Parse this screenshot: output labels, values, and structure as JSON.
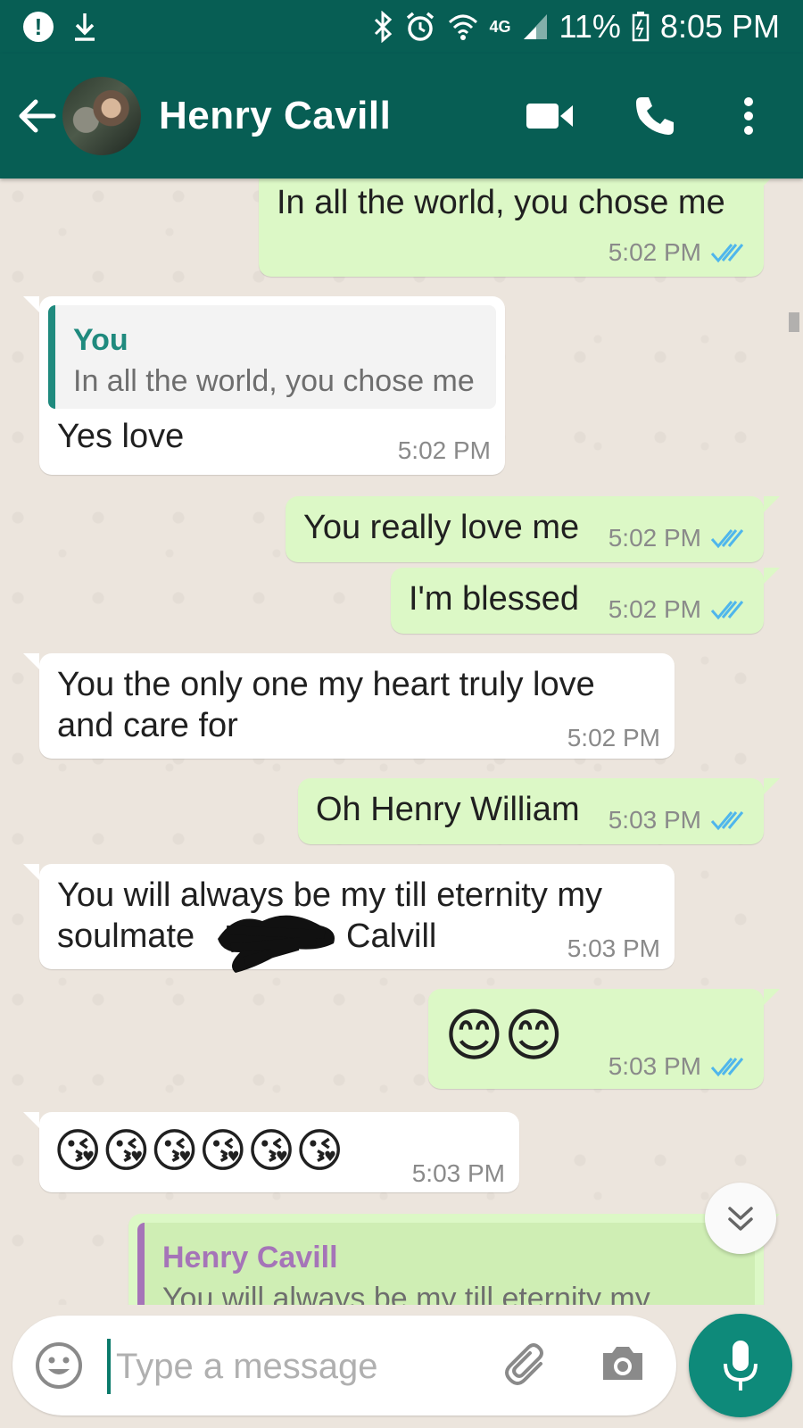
{
  "status_bar": {
    "network": "4G",
    "battery": "11%",
    "time": "8:05 PM"
  },
  "header": {
    "contact_name": "Henry Cavill",
    "icons": [
      "back-arrow-icon",
      "video-call-icon",
      "phone-icon",
      "more-options-icon"
    ]
  },
  "messages": [
    {
      "direction": "out",
      "text": "In all the world, you chose me",
      "time": "5:02 PM",
      "read": true
    },
    {
      "direction": "in",
      "quote": {
        "name": "You",
        "text": "In all the world, you chose me"
      },
      "text": "Yes love",
      "time": "5:02 PM"
    },
    {
      "direction": "out",
      "text": "You really love me",
      "time": "5:02 PM",
      "read": true
    },
    {
      "direction": "out",
      "text": "I'm blessed",
      "time": "5:02 PM",
      "read": true
    },
    {
      "direction": "in",
      "text_line1": "You the only one my heart truly love",
      "text_line2": "and care for",
      "time": "5:02 PM"
    },
    {
      "direction": "out",
      "text": "Oh Henry William",
      "time": "5:03 PM",
      "read": true
    },
    {
      "direction": "in",
      "text_line1": "You will always be my till eternity my",
      "text_line2_start": "soulmate",
      "text_line2_end": "Calvill",
      "time": "5:03 PM"
    },
    {
      "direction": "out",
      "emoji": "😊😊",
      "time": "5:03 PM",
      "read": true
    },
    {
      "direction": "in",
      "emoji": "😘😘😘😘😘😘",
      "time": "5:03 PM"
    },
    {
      "direction": "out",
      "quote": {
        "name": "Henry Cavill",
        "text": "You will always be my till eternity my"
      }
    }
  ],
  "input": {
    "placeholder": "Type a message"
  },
  "colors": {
    "header": "#075e54",
    "outgoing_bubble": "#dcf8c6",
    "incoming_bubble": "#ffffff",
    "read_ticks": "#4fb6ec",
    "accent": "#0e8a7a"
  }
}
